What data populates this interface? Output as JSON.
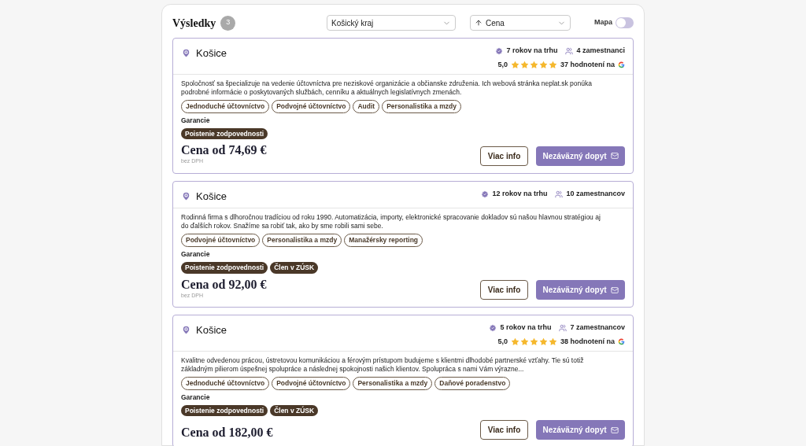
{
  "header": {
    "title": "Výsledky",
    "count": "3",
    "region_select": {
      "value": "Košický kraj"
    },
    "sort_select": {
      "value": "Cena"
    },
    "map_toggle": {
      "label": "Mapa",
      "on": false
    }
  },
  "results": [
    {
      "city": "Košice",
      "years": "7 rokov na trhu",
      "employees": "4 zamestnanci",
      "rating": {
        "score": "5,0",
        "stars": 5,
        "reviews": "37 hodnotení na"
      },
      "description": "Spoločnosť sa špecializuje na vedenie účtovníctva pre neziskové organizácie a občianske združenia. Ich webová stránka neplat.sk ponúka podrobné informácie o poskytovaných službách, cenníku a aktuálnych legislatívnych zmenách.",
      "services": [
        "Jednoduché účtovníctvo",
        "Podvojné účtovníctvo",
        "Audit",
        "Personalistika a mzdy"
      ],
      "guarantee_label": "Garancie",
      "guarantees": [
        "Poistenie zodpovednosti"
      ],
      "price": "Cena od 74,69 €",
      "price_note": "bez DPH",
      "more_button": "Viac info",
      "inquiry_button": "Nezáväzný dopyt"
    },
    {
      "city": "Košice",
      "years": "12 rokov na trhu",
      "employees": "10 zamestnancov",
      "description": "Rodinná firma s dlhoročnou tradíciou od roku 1990. Automatizácia, importy, elektronické spracovanie dokladov sú našou hlavnou stratégiou aj do ďalších rokov. Snažíme sa robiť tak, ako by sme robili sami sebe.",
      "services": [
        "Podvojné účtovníctvo",
        "Personalistika a mzdy",
        "Manažérsky reporting"
      ],
      "guarantee_label": "Garancie",
      "guarantees": [
        "Poistenie zodpovednosti",
        "Člen v ZÚSK"
      ],
      "price": "Cena od 92,00 €",
      "price_note": "bez DPH",
      "more_button": "Viac info",
      "inquiry_button": "Nezáväzný dopyt"
    },
    {
      "city": "Košice",
      "years": "5 rokov na trhu",
      "employees": "7 zamestnancov",
      "rating": {
        "score": "5,0",
        "stars": 5,
        "reviews": "38 hodnotení na"
      },
      "description": "Kvalitne odvedenou prácou, ústretovou komunikáciou a férovým prístupom budujeme s klientmi dlhodobé partnerské vzťahy. Tie sú totiž základným pilierom úspešnej spolupráce a následnej spokojnosti našich klientov. Spolupráca s nami Vám výrazne...",
      "services": [
        "Jednoduché účtovníctvo",
        "Podvojné účtovníctvo",
        "Personalistika a mzdy",
        "Daňové poradenstvo"
      ],
      "guarantee_label": "Garancie",
      "guarantees": [
        "Poistenie zodpovednosti",
        "Člen v ZÚSK"
      ],
      "price": "Cena od 182,00 €",
      "more_button": "Viac info",
      "inquiry_button": "Nezáväzný dopyt"
    }
  ]
}
